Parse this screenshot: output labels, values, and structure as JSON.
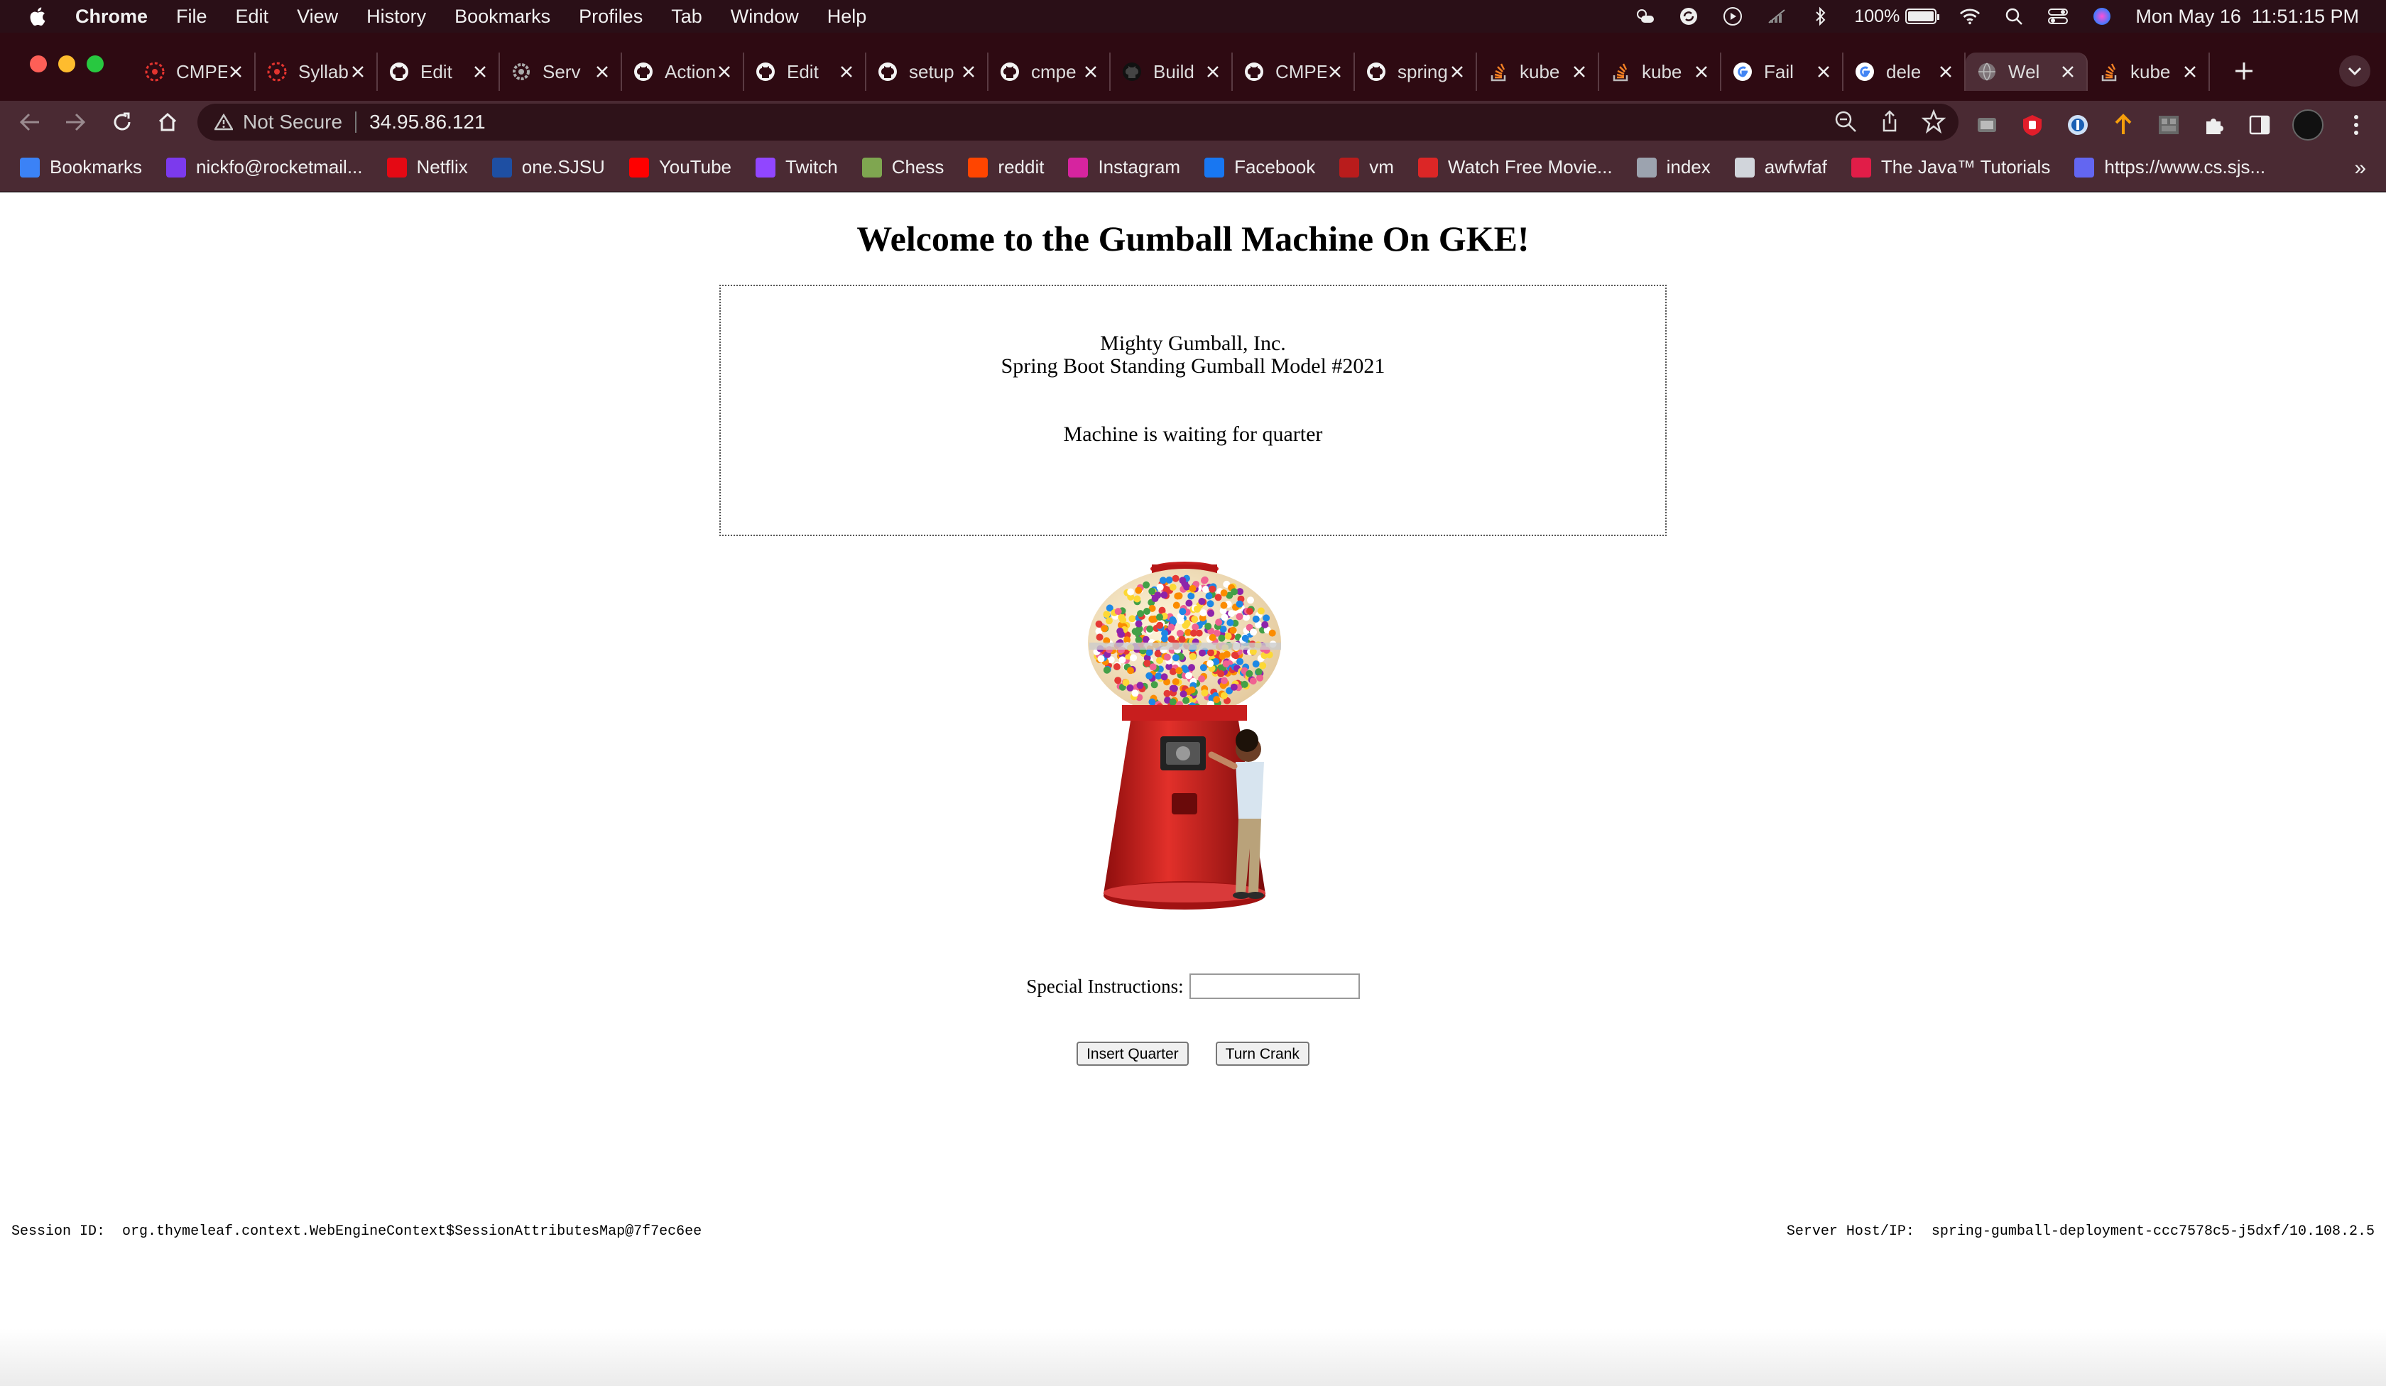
{
  "menubar": {
    "app_name": "Chrome",
    "items": [
      "File",
      "Edit",
      "View",
      "History",
      "Bookmarks",
      "Profiles",
      "Tab",
      "Window",
      "Help"
    ],
    "battery": "100%",
    "datetime": "Mon May 16  11:51:15 PM"
  },
  "tabs": [
    {
      "title": "CMPE",
      "icon": "sjsu-icon",
      "active": false
    },
    {
      "title": "Syllabus",
      "icon": "sjsu-icon",
      "active": false
    },
    {
      "title": "Edit",
      "icon": "github-icon",
      "active": false
    },
    {
      "title": "Serv",
      "icon": "gear-icon",
      "active": false
    },
    {
      "title": "Actions",
      "icon": "github-icon",
      "active": false
    },
    {
      "title": "Edit",
      "icon": "github-icon",
      "active": false
    },
    {
      "title": "setup",
      "icon": "github-icon",
      "active": false
    },
    {
      "title": "cmpe",
      "icon": "github-icon",
      "active": false
    },
    {
      "title": "Build",
      "icon": "github-dark-icon",
      "active": false
    },
    {
      "title": "CMPE",
      "icon": "github-icon",
      "active": false
    },
    {
      "title": "spring",
      "icon": "github-icon",
      "active": false
    },
    {
      "title": "kube",
      "icon": "stackoverflow-icon",
      "active": false
    },
    {
      "title": "kube",
      "icon": "stackoverflow-icon",
      "active": false
    },
    {
      "title": "Fail",
      "icon": "google-icon",
      "active": false
    },
    {
      "title": "dele",
      "icon": "google-icon",
      "active": false
    },
    {
      "title": "Wel",
      "icon": "globe-icon",
      "active": true
    },
    {
      "title": "kube",
      "icon": "stackoverflow-icon",
      "active": false
    }
  ],
  "address": {
    "security": "Not Secure",
    "url": "34.95.86.121"
  },
  "bookmarks": [
    {
      "label": "Bookmarks",
      "icon": "star-icon",
      "color": "#3b82f6"
    },
    {
      "label": "nickfo@rocketmail...",
      "icon": "mail-icon",
      "color": "#7c3aed"
    },
    {
      "label": "Netflix",
      "icon": "netflix-icon",
      "color": "#e50914"
    },
    {
      "label": "one.SJSU",
      "icon": "sjsu-icon",
      "color": "#1e4fa3"
    },
    {
      "label": "YouTube",
      "icon": "youtube-icon",
      "color": "#ff0000"
    },
    {
      "label": "Twitch",
      "icon": "twitch-icon",
      "color": "#9146ff"
    },
    {
      "label": "Chess",
      "icon": "chess-icon",
      "color": "#7fa650"
    },
    {
      "label": "reddit",
      "icon": "reddit-icon",
      "color": "#ff4500"
    },
    {
      "label": "Instagram",
      "icon": "instagram-icon",
      "color": "#d6249f"
    },
    {
      "label": "Facebook",
      "icon": "facebook-icon",
      "color": "#1877f2"
    },
    {
      "label": "vm",
      "icon": "vm-icon",
      "color": "#b91c1c"
    },
    {
      "label": "Watch Free Movie...",
      "icon": "movie-icon",
      "color": "#dc2626"
    },
    {
      "label": "index",
      "icon": "globe-icon",
      "color": "#9ca3af"
    },
    {
      "label": "awfwfaf",
      "icon": "folder-icon",
      "color": "#d1d5db"
    },
    {
      "label": "The Java™ Tutorials",
      "icon": "oracle-icon",
      "color": "#e11d48"
    },
    {
      "label": "https://www.cs.sjs...",
      "icon": "link-icon",
      "color": "#6366f1"
    }
  ],
  "page": {
    "heading": "Welcome to the Gumball Machine On GKE!",
    "company": "Mighty Gumball, Inc.",
    "model": "Spring Boot Standing Gumball Model #2021",
    "status": "Machine is waiting for quarter",
    "instructions_label": "Special Instructions:",
    "instructions_value": "",
    "insert_button": "Insert Quarter",
    "crank_button": "Turn Crank",
    "session_label": "Session ID:",
    "session_value": "org.thymeleaf.context.WebEngineContext$SessionAttributesMap@7f7ec6ee",
    "server_label": "Server Host/IP:",
    "server_value": "spring-gumball-deployment-ccc7578c5-j5dxf/10.108.2.5"
  }
}
